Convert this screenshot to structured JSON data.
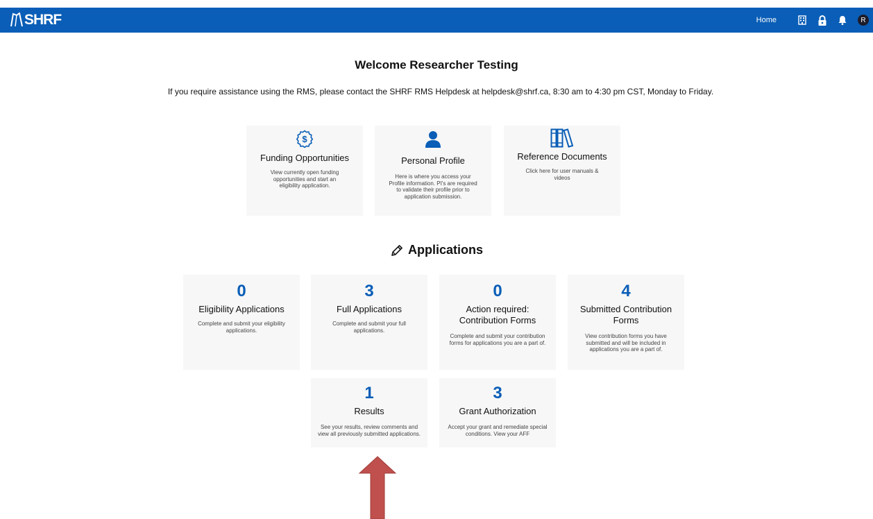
{
  "brand": {
    "logo_text": "SHRF"
  },
  "nav": {
    "home_label": "Home",
    "avatar_initial": "R"
  },
  "welcome": {
    "title": "Welcome Researcher Testing",
    "notice": "If you require assistance using the RMS, please contact the SHRF RMS Helpdesk at helpdesk@shrf.ca, 8:30 am to 4:30 pm CST, Monday to Friday."
  },
  "quick_links": [
    {
      "title": "Funding Opportunities",
      "desc": "View currently open funding opportunities and start an eligibility application.",
      "icon": "dollar-circle-icon"
    },
    {
      "title": "Personal Profile",
      "desc": "Here is where you access your Profile information. PI's are required to validate their profile prior to application submission.",
      "icon": "person-icon"
    },
    {
      "title": "Reference Documents",
      "desc": "Click here for user manuals & videos",
      "icon": "books-icon"
    }
  ],
  "applications": {
    "heading": "Applications",
    "cards": [
      {
        "count": "0",
        "title": "Eligibility Applications",
        "desc": "Complete and submit your eligibility applications."
      },
      {
        "count": "3",
        "title": "Full Applications",
        "desc": "Complete and submit your full applications."
      },
      {
        "count": "0",
        "title": "Action required: Contribution Forms",
        "desc": "Complete and submit your contribution forms for applications you are a part of."
      },
      {
        "count": "4",
        "title": "Submitted Contribution Forms",
        "desc": "View contribution forms you have submitted and will be included in applications you are a part of."
      },
      {
        "count": "1",
        "title": "Results",
        "desc": "See your results, review comments and view all previously submitted applications."
      },
      {
        "count": "3",
        "title": "Grant Authorization",
        "desc": "Accept your grant and remediate special conditions. View your AFF"
      }
    ]
  },
  "colors": {
    "brand_blue": "#0a5eb7",
    "card_bg": "#f7f7f7",
    "arrow": "#c0504d"
  }
}
